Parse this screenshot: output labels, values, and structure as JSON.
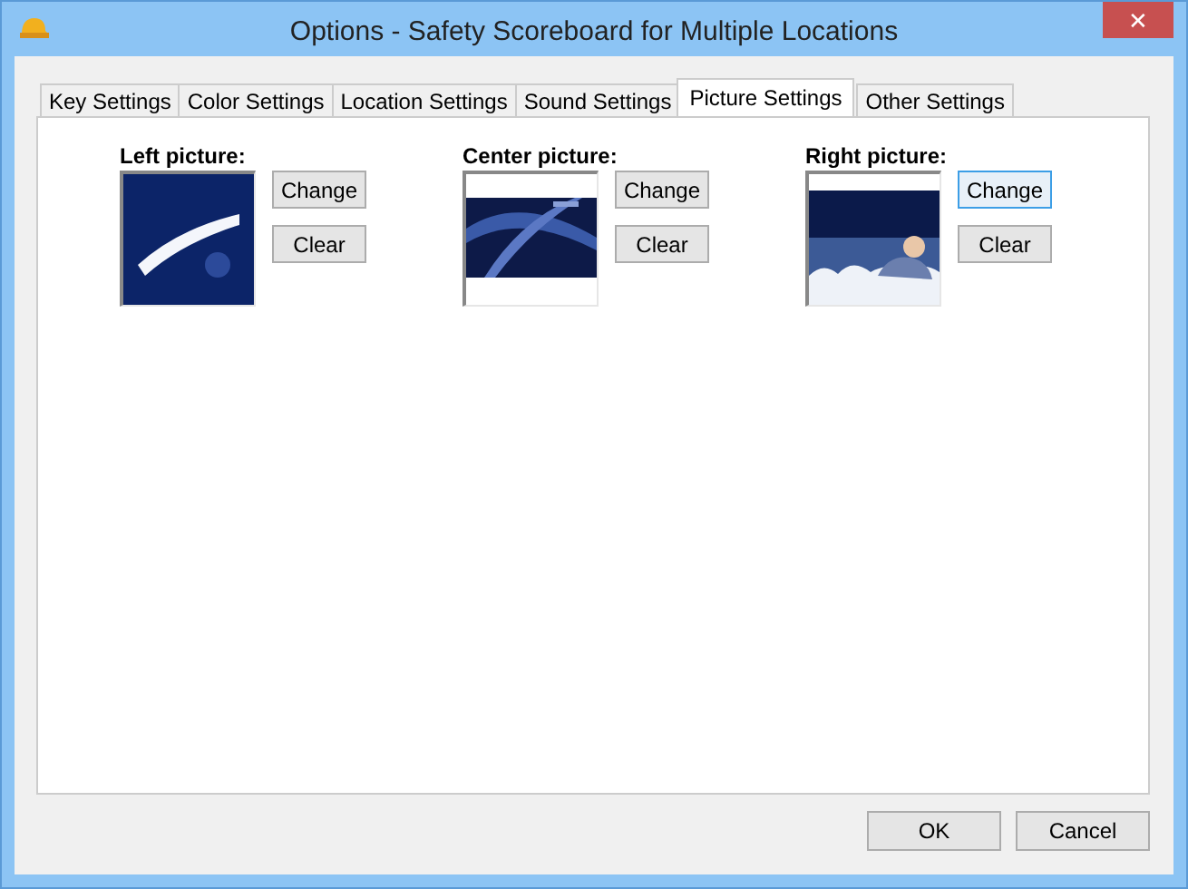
{
  "window": {
    "title": "Options - Safety Scoreboard for Multiple Locations",
    "close": "✕"
  },
  "tabs": [
    {
      "label": "Key Settings",
      "selected": false
    },
    {
      "label": "Color Settings",
      "selected": false
    },
    {
      "label": "Location Settings",
      "selected": false
    },
    {
      "label": "Sound Settings",
      "selected": false
    },
    {
      "label": "Picture Settings",
      "selected": true
    },
    {
      "label": "Other Settings",
      "selected": false
    }
  ],
  "slots": [
    {
      "label": "Left picture:",
      "change": "Change",
      "clear": "Clear",
      "change_focused": false
    },
    {
      "label": "Center picture:",
      "change": "Change",
      "clear": "Clear",
      "change_focused": false
    },
    {
      "label": "Right picture:",
      "change": "Change",
      "clear": "Clear",
      "change_focused": true
    }
  ],
  "buttons": [
    "OK",
    "Cancel"
  ]
}
